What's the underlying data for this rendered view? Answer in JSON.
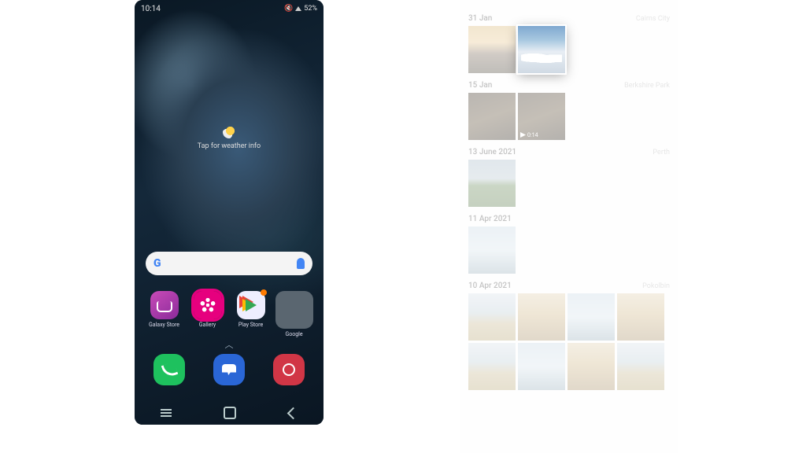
{
  "status": {
    "time": "10:14",
    "battery": "52%",
    "sound_icon": "volume-icon",
    "signal_icon": "signal-icon"
  },
  "weather": {
    "hint": "Tap for weather info"
  },
  "home_apps": [
    {
      "name": "galaxy-store",
      "label": "Galaxy Store"
    },
    {
      "name": "gallery",
      "label": "Gallery"
    },
    {
      "name": "play-store",
      "label": "Play Store"
    },
    {
      "name": "google",
      "label": "Google"
    }
  ],
  "dock_apps": [
    {
      "name": "phone"
    },
    {
      "name": "messages"
    },
    {
      "name": "camera"
    }
  ],
  "drawer_hint_glyph": "︿",
  "nav": {
    "recent": "recent",
    "home": "home",
    "back": "back"
  },
  "gallery": {
    "sections": [
      {
        "date": "31 Jan",
        "location": "Cairns City",
        "count": 2,
        "has_video": false,
        "selected_index": 1
      },
      {
        "date": "15 Jan",
        "location": "Berkshire Park",
        "count": 2,
        "has_video": true,
        "video_duration": "0:14"
      },
      {
        "date": "13 June 2021",
        "location": "Perth",
        "count": 1,
        "has_video": false
      },
      {
        "date": "11 Apr 2021",
        "location": "",
        "count": 1,
        "has_video": false
      },
      {
        "date": "10 Apr 2021",
        "location": "Pokolbin",
        "count": 8,
        "has_video": false
      }
    ]
  }
}
